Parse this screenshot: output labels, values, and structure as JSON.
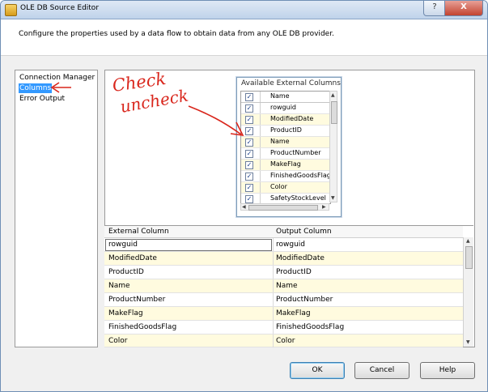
{
  "window": {
    "title": "OLE DB Source Editor",
    "help_glyph": "?",
    "close_glyph": "X"
  },
  "description": "Configure the properties used by a data flow to obtain data from any OLE DB provider.",
  "nav": {
    "items": [
      {
        "label": "Connection Manager",
        "selected": false
      },
      {
        "label": "Columns",
        "selected": true
      },
      {
        "label": "Error Output",
        "selected": false
      }
    ]
  },
  "available_columns": {
    "title": "Available External Columns",
    "header_label": "Name",
    "rows": [
      {
        "name": "rowguid",
        "checked": true
      },
      {
        "name": "ModifiedDate",
        "checked": true
      },
      {
        "name": "ProductID",
        "checked": true
      },
      {
        "name": "Name",
        "checked": true
      },
      {
        "name": "ProductNumber",
        "checked": true
      },
      {
        "name": "MakeFlag",
        "checked": true
      },
      {
        "name": "FinishedGoodsFlag",
        "checked": true
      },
      {
        "name": "Color",
        "checked": true
      },
      {
        "name": "SafetyStockLevel",
        "checked": true
      }
    ],
    "check_glyph": "✓"
  },
  "mapping_grid": {
    "headers": {
      "external": "External Column",
      "output": "Output Column"
    },
    "rows": [
      {
        "external": "rowguid",
        "output": "rowguid"
      },
      {
        "external": "ModifiedDate",
        "output": "ModifiedDate"
      },
      {
        "external": "ProductID",
        "output": "ProductID"
      },
      {
        "external": "Name",
        "output": "Name"
      },
      {
        "external": "ProductNumber",
        "output": "ProductNumber"
      },
      {
        "external": "MakeFlag",
        "output": "MakeFlag"
      },
      {
        "external": "FinishedGoodsFlag",
        "output": "FinishedGoodsFlag"
      },
      {
        "external": "Color",
        "output": "Color"
      }
    ]
  },
  "buttons": {
    "ok": "OK",
    "cancel": "Cancel",
    "help": "Help"
  },
  "annotation": {
    "line1": "Check",
    "line2": "uncheck",
    "color": "#d9261c"
  }
}
